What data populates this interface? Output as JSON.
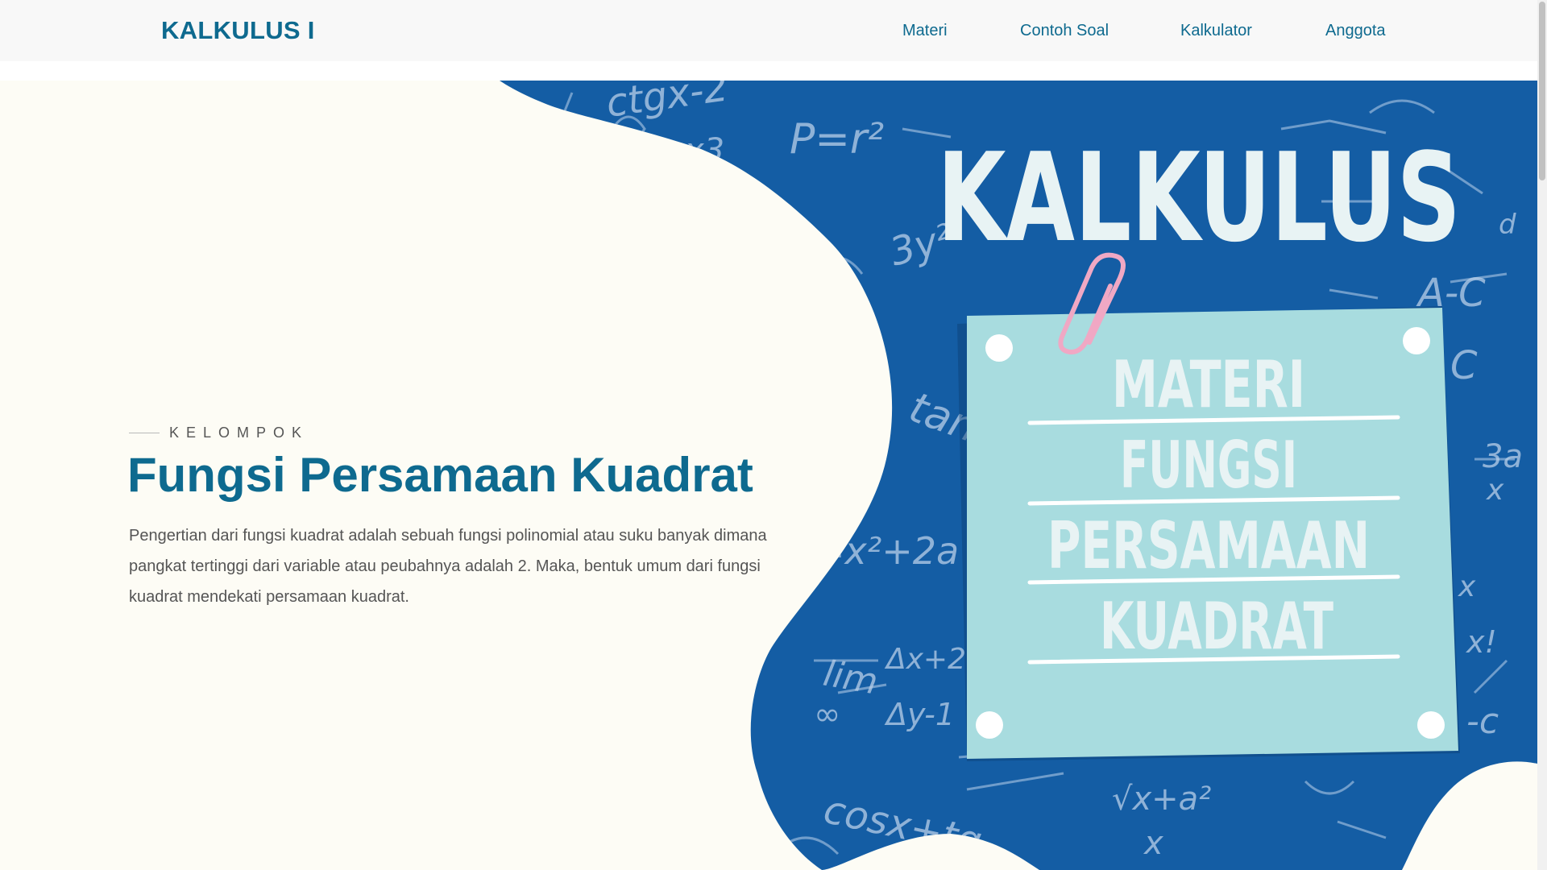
{
  "navbar": {
    "brand": "KALKULUS I",
    "links": [
      "Materi",
      "Contoh Soal",
      "Kalkulator",
      "Anggota"
    ]
  },
  "hero": {
    "eyebrow": "KELOMPOK",
    "title": "Fungsi Persamaan Kuadrat",
    "description": "Pengertian dari fungsi kuadrat adalah sebuah fungsi polinomial atau suku banyak dimana pangkat tertinggi dari variable atau peubahnya adalah 2. Maka, bentuk umum dari fungsi kuadrat mendekati persamaan kuadrat."
  },
  "banner": {
    "heading": "KALKULUS",
    "note_lines": [
      "MATERI",
      "FUNGSI",
      "PERSAMAAN",
      "KUADRAT"
    ],
    "scribbles": [
      "ctgx-2",
      "x3",
      "P=r²",
      "3y²",
      "tan",
      "=x²+2a",
      "lim",
      "Δx+2",
      "Δy-1",
      "∞",
      "cosx+tg",
      "√x+a²",
      "x",
      "3a",
      "x",
      "A-C",
      "C",
      "x!",
      "-c",
      "x",
      "d"
    ]
  },
  "colors": {
    "accent": "#0e6a8f",
    "banner_blue": "#145da4",
    "note": "#a8dcdf",
    "background": "#fdfcf5"
  }
}
